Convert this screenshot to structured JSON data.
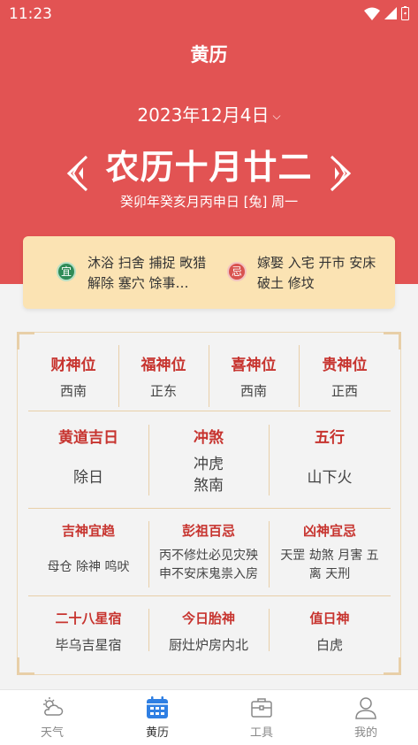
{
  "status": {
    "time": "11:23"
  },
  "appbar": {
    "title": "黄历"
  },
  "date": {
    "solar": "2023年12月4日",
    "lunar": "农历十月廿二",
    "ganzhi": "癸卯年癸亥月丙申日 [兔] 周一"
  },
  "yiji": {
    "yi_badge": "宜",
    "yi_text": "沐浴 扫舍 捕捉 畋猎 解除 塞穴 馀事…",
    "ji_badge": "忌",
    "ji_text": "嫁娶 入宅 开市 安床 破土 修坟"
  },
  "positions": [
    {
      "title": "财神位",
      "value": "西南"
    },
    {
      "title": "福神位",
      "value": "正东"
    },
    {
      "title": "喜神位",
      "value": "西南"
    },
    {
      "title": "贵神位",
      "value": "正西"
    }
  ],
  "row2": [
    {
      "title": "黄道吉日",
      "value": "除日"
    },
    {
      "title": "冲煞",
      "value": "冲虎\n煞南"
    },
    {
      "title": "五行",
      "value": "山下火"
    }
  ],
  "row3": [
    {
      "title": "吉神宜趋",
      "value": "母仓 除神 鸣吠"
    },
    {
      "title": "彭祖百忌",
      "value": "丙不修灶必见灾殃\n申不安床鬼祟入房"
    },
    {
      "title": "凶神宜忌",
      "value": "天罡 劫煞 月害 五\n离 天刑"
    }
  ],
  "row4": [
    {
      "title": "二十八星宿",
      "value": "毕乌吉星宿"
    },
    {
      "title": "今日胎神",
      "value": "厨灶炉房内北"
    },
    {
      "title": "值日神",
      "value": "白虎"
    }
  ],
  "tabs": [
    {
      "label": "天气",
      "icon": "weather-icon"
    },
    {
      "label": "黄历",
      "icon": "calendar-icon"
    },
    {
      "label": "工具",
      "icon": "toolbox-icon"
    },
    {
      "label": "我的",
      "icon": "user-icon"
    }
  ],
  "colors": {
    "header": "#e25353",
    "accent": "#c7342f",
    "panel": "#fbe3b3",
    "active_tab": "#2f7fe3"
  }
}
